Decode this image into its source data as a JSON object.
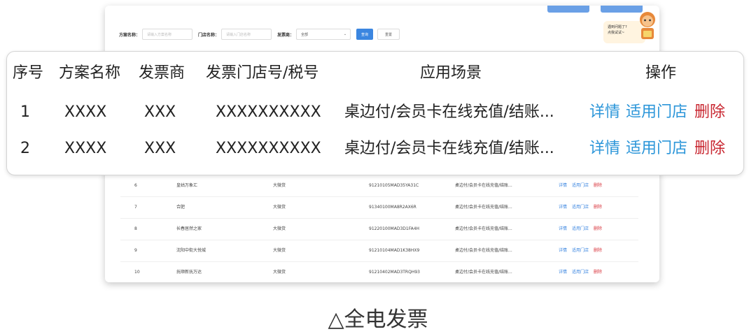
{
  "filter": {
    "scheme_label": "方案名称：",
    "scheme_placeholder": "请输入方案名称",
    "store_label": "门店名称：",
    "store_placeholder": "请输入门店名称",
    "issuer_label": "发票商：",
    "issuer_value": "全部",
    "query_button": "查询",
    "reset_button": "重置"
  },
  "mascot": {
    "line1": "遇到问题了?",
    "line2": "点我试试~"
  },
  "background_rows": [
    {
      "idx": "6",
      "name": "皇姑万象汇",
      "issuer": "大微货",
      "tax": "91210105MAD35YA31C",
      "scene": "桌边付/会员卡在线充值/结账...",
      "detail": "详情",
      "stores": "适用门店",
      "delete": "删除"
    },
    {
      "idx": "7",
      "name": "合肥",
      "issuer": "大微货",
      "tax": "91340100MA8R2AX6R",
      "scene": "桌边付/会员卡在线充值/结账...",
      "detail": "详情",
      "stores": "适用门店",
      "delete": "删除"
    },
    {
      "idx": "8",
      "name": "长春居然之家",
      "issuer": "大微货",
      "tax": "91220100MAD3D1FA4H",
      "scene": "桌边付/会员卡在线充值/结账...",
      "detail": "详情",
      "stores": "适用门店",
      "delete": "删除"
    },
    {
      "idx": "9",
      "name": "沈阳中街大悦城",
      "issuer": "大微货",
      "tax": "91210104MAD1K38HX9",
      "scene": "桌边付/会员卡在线充值/结账...",
      "detail": "详情",
      "stores": "适用门店",
      "delete": "删除"
    },
    {
      "idx": "10",
      "name": "抚顺新抚万达",
      "issuer": "大微货",
      "tax": "91210402MAD3TRQH93",
      "scene": "桌边付/会员卡在线充值/结账...",
      "detail": "详情",
      "stores": "适用门店",
      "delete": "删除"
    }
  ],
  "overlay_table": {
    "headers": {
      "idx": "序号",
      "name": "方案名称",
      "issuer": "发票商",
      "store": "发票门店号/税号",
      "scene": "应用场景",
      "ops": "操作"
    },
    "rows": [
      {
        "idx": "1",
        "name": "XXXX",
        "issuer": "XXX",
        "store": "XXXXXXXXXX",
        "scene": "桌边付/会员卡在线充值/结账...",
        "detail": "详情",
        "stores": "适用门店",
        "delete": "删除"
      },
      {
        "idx": "2",
        "name": "XXXX",
        "issuer": "XXX",
        "store": "XXXXXXXXXX",
        "scene": "桌边付/会员卡在线充值/结账...",
        "detail": "详情",
        "stores": "适用门店",
        "delete": "删除"
      }
    ]
  },
  "caption": "△全电发票",
  "colors": {
    "link": "#2c96d9",
    "delete": "#c8252f",
    "primary_button": "#3b86e0"
  }
}
